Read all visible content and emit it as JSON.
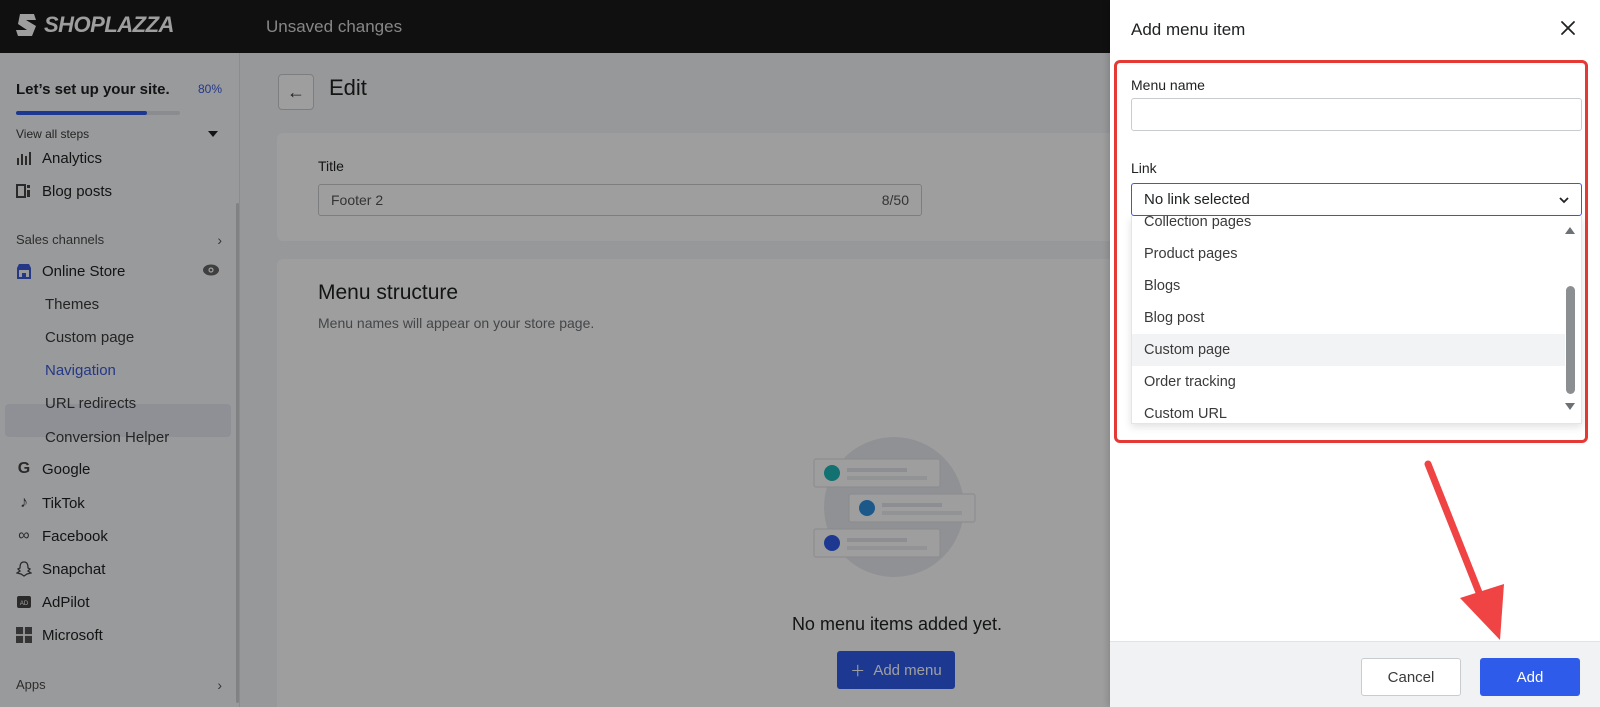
{
  "topbar": {
    "logo_text": "SHOPLAZZA",
    "status_text": "Unsaved changes"
  },
  "sidebar": {
    "setup_title": "Let’s set up your site.",
    "setup_percent": "80%",
    "setup_progress": 0.8,
    "view_steps": "View all steps",
    "items": [
      {
        "label": "Analytics",
        "icon": "analytics-icon"
      },
      {
        "label": "Blog posts",
        "icon": "blog-posts-icon"
      }
    ],
    "sales_channels_label": "Sales channels",
    "online_store": {
      "label": "Online Store",
      "icon": "store-icon",
      "eye_icon": "eye-icon"
    },
    "sub_items": [
      "Themes",
      "Custom page",
      "Navigation",
      "URL redirects",
      "Conversion Helper"
    ],
    "active_sub_item": "Navigation",
    "channels": [
      {
        "label": "Google",
        "icon": "google-icon"
      },
      {
        "label": "TikTok",
        "icon": "tiktok-icon"
      },
      {
        "label": "Facebook",
        "icon": "meta-icon"
      },
      {
        "label": "Snapchat",
        "icon": "snapchat-icon"
      },
      {
        "label": "AdPilot",
        "icon": "adpilot-icon"
      },
      {
        "label": "Microsoft",
        "icon": "microsoft-icon"
      }
    ],
    "apps_label": "Apps"
  },
  "main": {
    "page_title": "Edit",
    "title_label": "Title",
    "title_value": "Footer 2",
    "title_count": "8/50",
    "menu_heading": "Menu structure",
    "menu_subtext": "Menu names will appear on your store page.",
    "empty_text": "No menu items added yet.",
    "add_menu_label": "Add menu"
  },
  "drawer": {
    "title": "Add menu item",
    "menu_name_label": "Menu name",
    "menu_name_value": "",
    "link_label": "Link",
    "link_selected": "No link selected",
    "options": [
      "Collection pages",
      "Product pages",
      "Blogs",
      "Blog post",
      "Custom page",
      "Order tracking",
      "Custom URL"
    ],
    "hovered_option": "Custom page",
    "cancel_label": "Cancel",
    "add_label": "Add"
  },
  "colors": {
    "accent": "#2f5bea",
    "annotation": "#e53935",
    "topbar": "#1a1a1a"
  }
}
